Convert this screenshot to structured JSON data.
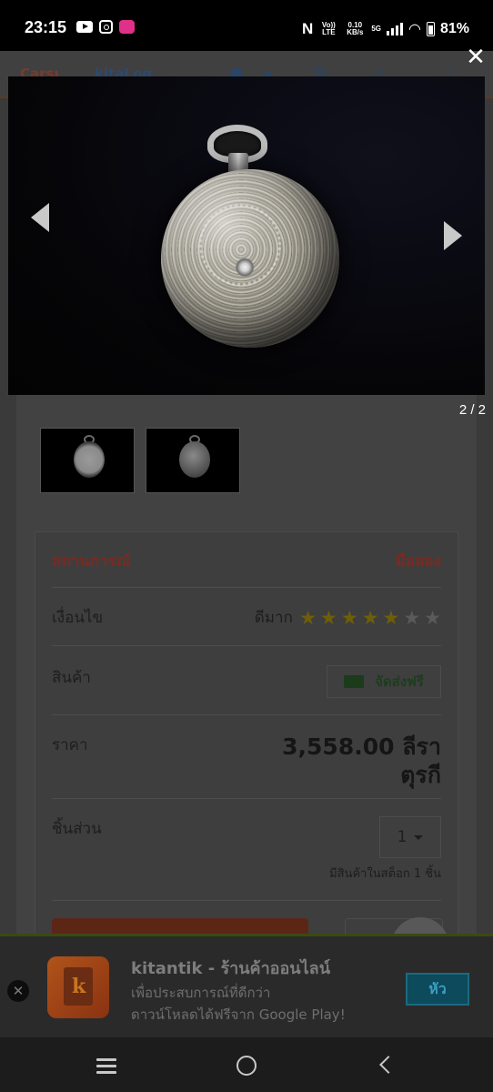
{
  "status_bar": {
    "time": "23:15",
    "network_top": "Vo)) LTE",
    "speed": "0.10 KB/s",
    "net_type": "5G",
    "battery": "81%"
  },
  "page": {
    "brand1": "Çarşı",
    "brand2": "kitaLog"
  },
  "lightbox": {
    "close": "✕",
    "counter": "2 / 2"
  },
  "product": {
    "status_label": "สถานการณ์",
    "status_value": "มือสอง",
    "condition_label": "เงื่อนไข",
    "condition_value": "ดีมาก",
    "rating": 5,
    "rating_max": 7,
    "item_label": "สินค้า",
    "shipping_label": "จัดส่งฟรี",
    "price_label": "ราคา",
    "price_value": "3,558.00 ลีรา ตุรกี",
    "quantity_label": "ชิ้นส่วน",
    "quantity_value": "1",
    "stock_text": "มีสินค้าในสต็อก 1 ชิ้น"
  },
  "ad": {
    "title": "kitantik - ร้านค้าออนไลน์",
    "line1": "เพื่อประสบการณ์ที่ดีกว่า",
    "line2": "ดาวน์โหลดได้ฟรีจาก Google Play!",
    "button": "หัว",
    "close": "✕"
  }
}
